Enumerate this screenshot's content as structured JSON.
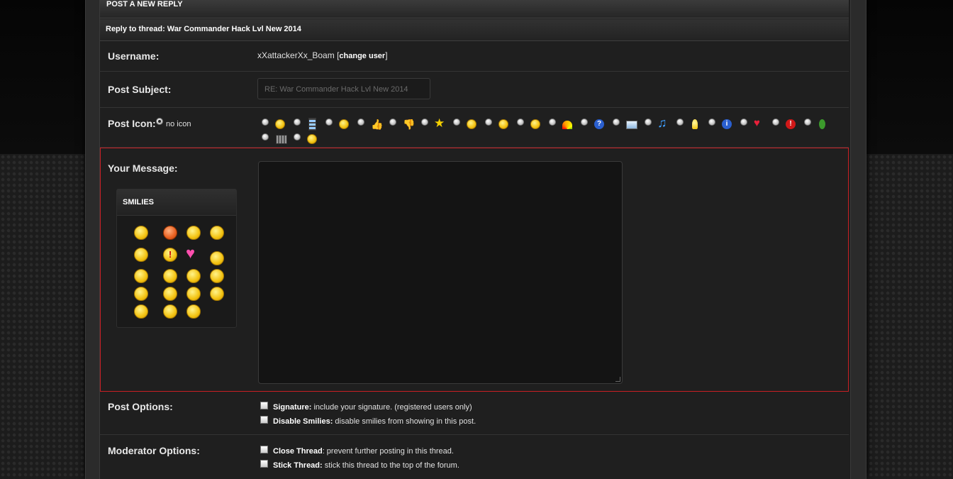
{
  "header": {
    "title": "POST A NEW REPLY",
    "subtitle": "Reply to thread: War Commander Hack Lvl New 2014"
  },
  "username": {
    "label": "Username:",
    "value": "xXattackerXx_Boam",
    "bracket_open": "[",
    "change_user": "change user",
    "bracket_close": "]"
  },
  "subject": {
    "label": "Post Subject:",
    "value": "RE: War Commander Hack Lvl New 2014"
  },
  "post_icon": {
    "label": "Post Icon:",
    "no_icon": "no icon",
    "icons": [
      "smile-icon",
      "film-icon",
      "tongue-icon",
      "thumbs-up-icon",
      "thumbs-down-icon",
      "star-icon",
      "neutral-face-icon",
      "angry-face-icon",
      "confused-face-icon",
      "rainbow-icon",
      "question-icon",
      "envelope-icon",
      "music-note-icon",
      "lightbulb-icon",
      "info-icon",
      "heart-icon",
      "exclamation-icon",
      "bug-icon",
      "clapper-icon",
      "grin-icon"
    ]
  },
  "message": {
    "label": "Your Message:",
    "smilies_title": "SMILIES",
    "smilies": [
      "angel-smiley",
      "mad-smiley",
      "confused-smiley",
      "eek-smiley",
      "cool-smiley",
      "exclamation-smiley",
      "heart-smiley",
      "puzzled-smiley",
      "idea-smiley",
      "roll-eyes-smiley",
      "thinking-smiley",
      "happy-smiley",
      "big-smile-smiley",
      "shades-smiley",
      "grin-smiley",
      "tongue-smiley",
      "wink-smiley",
      "frown-smiley",
      "sad-smiley"
    ]
  },
  "post_options": {
    "label": "Post Options:",
    "signature_label": "Signature:",
    "signature_text": " include your signature. (registered users only)",
    "smilies_label": "Disable Smilies:",
    "smilies_text": " disable smilies from showing in this post."
  },
  "moderator_options": {
    "label": "Moderator Options:",
    "close_label": "Close Thread",
    "close_text": ": prevent further posting in this thread.",
    "stick_label": "Stick Thread:",
    "stick_text": " stick this thread to the top of the forum."
  },
  "colors": {
    "highlight_border": "#c81f24",
    "panel_bg": "#1f1f1f"
  }
}
